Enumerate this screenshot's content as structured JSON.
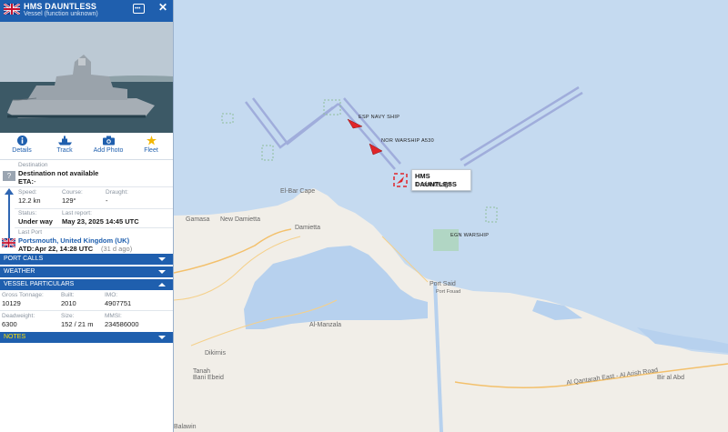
{
  "panel": {
    "vessel_name": "HMS DAUNTLESS",
    "vessel_type": "Vessel (function unknown)",
    "tabs": [
      {
        "label": "Details",
        "icon": "info-icon"
      },
      {
        "label": "Track",
        "icon": "track-icon"
      },
      {
        "label": "Add Photo",
        "icon": "camera-icon"
      },
      {
        "label": "Fleet",
        "icon": "star-icon"
      }
    ],
    "destination": {
      "label": "Destination",
      "value": "Destination not available",
      "eta_label": "ETA:",
      "eta_value": "-"
    },
    "speed": {
      "label": "Speed:",
      "value": "12.2 kn"
    },
    "course": {
      "label": "Course:",
      "value": "129°"
    },
    "draught": {
      "label": "Draught:",
      "value": "-"
    },
    "status": {
      "label": "Status:",
      "value": "Under way"
    },
    "last_report": {
      "label": "Last report:",
      "value": "May 23, 2025 14:45 UTC"
    },
    "last_port": {
      "label": "Last Port",
      "value": "Portsmouth, United Kingdom (UK)",
      "atd_label": "ATD:",
      "atd_value": "Apr 22, 14:28 UTC",
      "atd_ago": "(31 d ago)"
    },
    "sections": {
      "port_calls": "PORT CALLS",
      "weather": "WEATHER",
      "vessel_particulars": "VESSEL PARTICULARS",
      "notes": "NOTES"
    },
    "particulars": {
      "gross_tonnage_label": "Gross Tonnage:",
      "gross_tonnage": "10129",
      "built_label": "Built:",
      "built": "2010",
      "imo_label": "IMO:",
      "imo": "4907751",
      "deadweight_label": "Deadweight:",
      "deadweight": "6300",
      "size_label": "Size:",
      "size": "152 / 21 m",
      "mmsi_label": "MMSI:",
      "mmsi": "234586000"
    },
    "colors": {
      "header": "#1f5fae",
      "notes_text": "#ffe000"
    }
  },
  "map": {
    "popup": {
      "name": "HMS DAUNTLESS",
      "time": "1 minute ago"
    },
    "ships": [
      {
        "label": "ESP NAVY SHIP"
      },
      {
        "label": "NOR WARSHIP A530"
      },
      {
        "label": "EGN WARSHIP"
      }
    ],
    "places": [
      "El-Bar Cape",
      "Gamasa",
      "New Damietta",
      "Damietta",
      "Port Said",
      "Port Fouad",
      "Al-Manzala",
      "Dikirnis",
      "Tanah",
      "Bani Ebeid",
      "Bir al Abd",
      "Al Qantarah East - Al Arish Road",
      "Balawin"
    ],
    "colors": {
      "sea": "#c5daf0",
      "land": "#f2efe9",
      "ship_marker": "#e0252a"
    }
  }
}
